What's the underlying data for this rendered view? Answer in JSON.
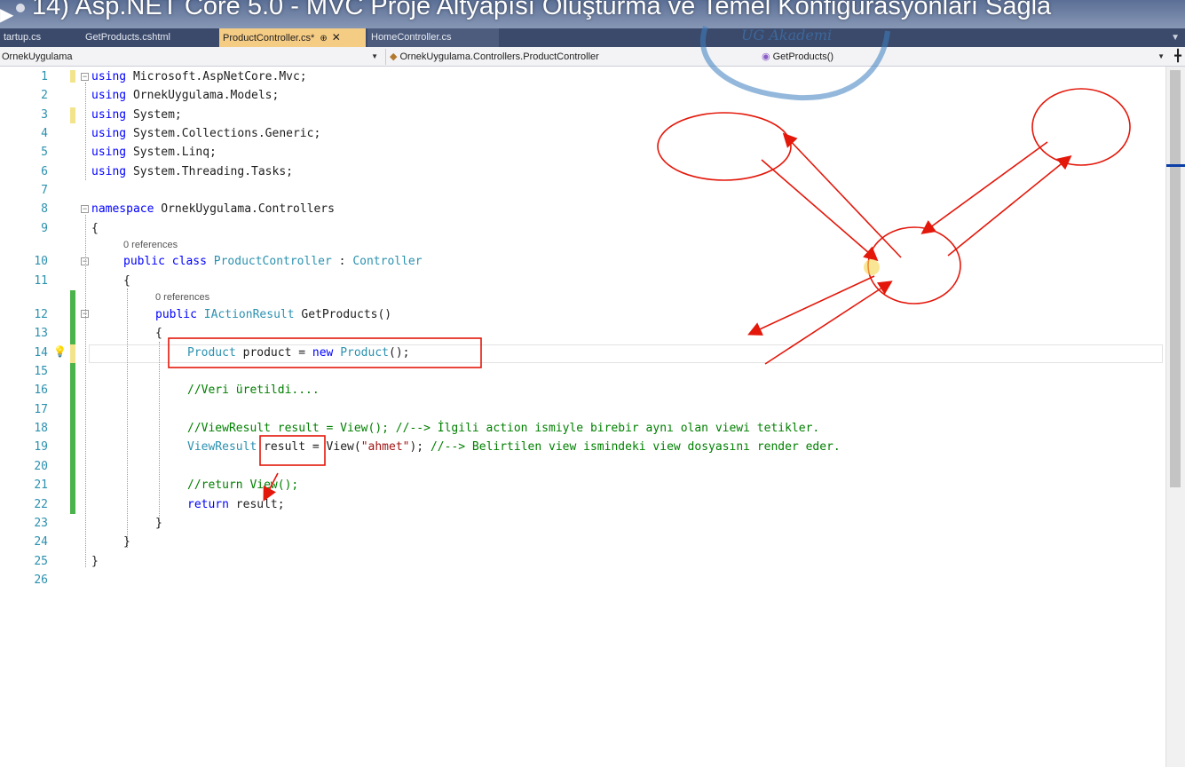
{
  "video_title": "14) Asp.NET Core 5.0 - MVC Proje Altyapısı Oluşturma ve Temel Konfigurasyonları Sağla",
  "tabs": [
    {
      "label": "tartup.cs",
      "active": false
    },
    {
      "label": "GetProducts.cshtml",
      "active": false
    },
    {
      "label": "ProductController.cs*",
      "active": true
    },
    {
      "label": "HomeController.cs",
      "active": false
    }
  ],
  "nav": {
    "project": "OrnekUygulama",
    "class": "OrnekUygulama.Controllers.ProductController",
    "member": "GetProducts()"
  },
  "watermark": "UG Akademi",
  "codelens": [
    "0 references",
    "0 references"
  ],
  "line_numbers": [
    "1",
    "2",
    "3",
    "4",
    "5",
    "6",
    "7",
    "8",
    "9",
    "10",
    "11",
    "12",
    "13",
    "14",
    "15",
    "16",
    "17",
    "18",
    "19",
    "20",
    "21",
    "22",
    "23",
    "24",
    "25",
    "26"
  ],
  "code": {
    "l1": [
      "using",
      " Microsoft.AspNetCore.Mvc;"
    ],
    "l2": [
      "using",
      " OrnekUygulama.Models;"
    ],
    "l3": [
      "using",
      " System;"
    ],
    "l4": [
      "using",
      " System.Collections.Generic;"
    ],
    "l5": [
      "using",
      " System.Linq;"
    ],
    "l6": [
      "using",
      " System.Threading.Tasks;"
    ],
    "l8": [
      "namespace",
      " OrnekUygulama.Controllers"
    ],
    "l9": "{",
    "l10": [
      "public",
      " ",
      "class",
      " ",
      "ProductController",
      " : ",
      "Controller"
    ],
    "l11": "{",
    "l12": [
      "public",
      " ",
      "IActionResult",
      " GetProducts()"
    ],
    "l13": "{",
    "l14": [
      "Product",
      " product = ",
      "new",
      " ",
      "Product",
      "();"
    ],
    "l16": "//Veri üretildi....",
    "l18": "//ViewResult result = View(); //--> İlgili action ismiyle birebir aynı olan viewi tetikler.",
    "l19": [
      "ViewResult",
      " result = View(",
      "\"ahmet\"",
      "); ",
      "//--> Belirtilen view ismindeki view dosyasını render eder."
    ],
    "l21": "//return View();",
    "l22": [
      "return",
      " result;"
    ],
    "l23": "}",
    "l24": "}",
    "l25": "}"
  },
  "colors": {
    "keyword": "#0000ff",
    "type": "#2b91af",
    "comment": "#008000",
    "string": "#a31515",
    "annotation_red": "#e3170a",
    "tab_active": "#f5cc84",
    "tab_strip": "#3b4a6b"
  },
  "icons": [
    "play-icon",
    "class-icon",
    "method-icon",
    "lightbulb-icon",
    "dropdown-arrow-icon",
    "close-icon",
    "pin-icon"
  ]
}
